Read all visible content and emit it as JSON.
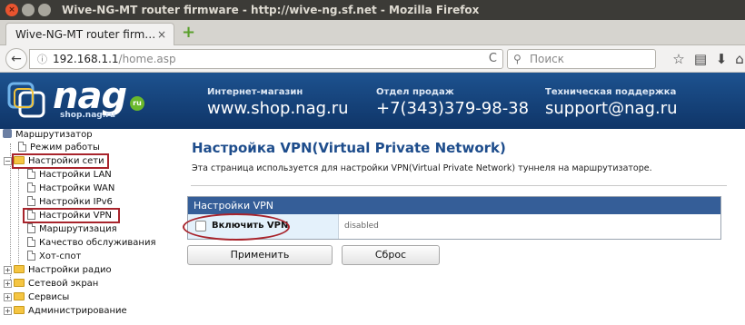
{
  "window": {
    "title": "Wive-NG-MT router firmware - http://wive-ng.sf.net - Mozilla Firefox"
  },
  "tab": {
    "label": "Wive-NG-MT router firm…",
    "close": "×",
    "new_tab": "+"
  },
  "nav": {
    "back": "←",
    "info": "ⓘ",
    "url_host": "192.168.1.1",
    "url_path": "/home.asp",
    "reload": "C",
    "search_placeholder": "Поиск",
    "search_icon": "search-icon",
    "bookmark": "☆",
    "library": "▤",
    "download": "⬇",
    "home": "⌂"
  },
  "banner": {
    "logo": "nag",
    "logo_sub": "shop.nag.ru",
    "logo_ru": "ru",
    "shop_label": "Интернет-магазин",
    "shop_value": "www.shop.nag.ru",
    "sales_label": "Отдел продаж",
    "sales_value": "+7(343)379-98-38",
    "support_label": "Техническая поддержка",
    "support_value": "support@nag.ru"
  },
  "tree": {
    "root": "Маршрутизатор",
    "mode": "Режим работы",
    "network": "Настройки сети",
    "lan": "Настройки LAN",
    "wan": "Настройки WAN",
    "ipv6": "Настройки IPv6",
    "vpn": "Настройки VPN",
    "routing": "Маршрутизация",
    "qos": "Качество обслуживания",
    "hotspot": "Хот-спот",
    "radio": "Настройки радио",
    "firewall": "Сетевой экран",
    "services": "Сервисы",
    "admin": "Администрирование"
  },
  "main": {
    "title": "Настройка VPN(Virtual Private Network)",
    "description": "Эта страница используется для настройки VPN(Virtual Private Network) туннеля на маршрутизаторе.",
    "table_header": "Настройки VPN",
    "enable_label": "Включить VPN",
    "status": "disabled",
    "apply": "Применить",
    "reset": "Сброс"
  },
  "colors": {
    "accent": "#1e4d8c",
    "header": "#355e98",
    "highlight": "#a8242c"
  }
}
